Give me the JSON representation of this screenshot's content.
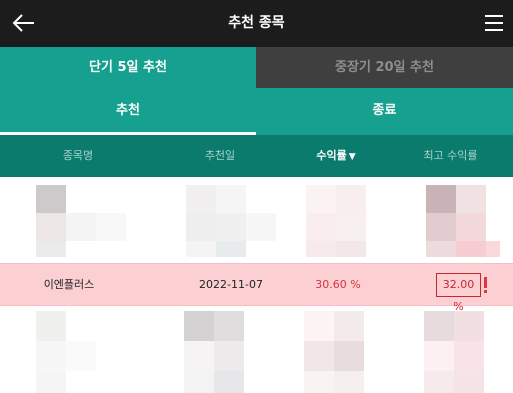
{
  "header": {
    "title": "추천 종목"
  },
  "tabs_primary": [
    {
      "label": "단기 5일 추천",
      "active": true
    },
    {
      "label": "중장기 20일 추천",
      "active": false
    }
  ],
  "tabs_secondary": [
    {
      "label": "추천",
      "active": true
    },
    {
      "label": "종료",
      "active": false
    }
  ],
  "columns": {
    "name": "종목명",
    "date": "추천일",
    "return": "수익률",
    "return_sort_icon": "▼",
    "max_return": "최고 수익률"
  },
  "highlighted_row": {
    "name": "이엔플러스",
    "date": "2022-11-07",
    "return": "30.60 %",
    "max_return": "32.00 %"
  },
  "colors": {
    "topbar": "#1c1c1c",
    "teal": "#16a08f",
    "dark_teal": "#0a7b6d",
    "inactive_tab": "#3f3f3f",
    "highlight_row": "#fccfd2",
    "accent_red": "#c62733"
  }
}
